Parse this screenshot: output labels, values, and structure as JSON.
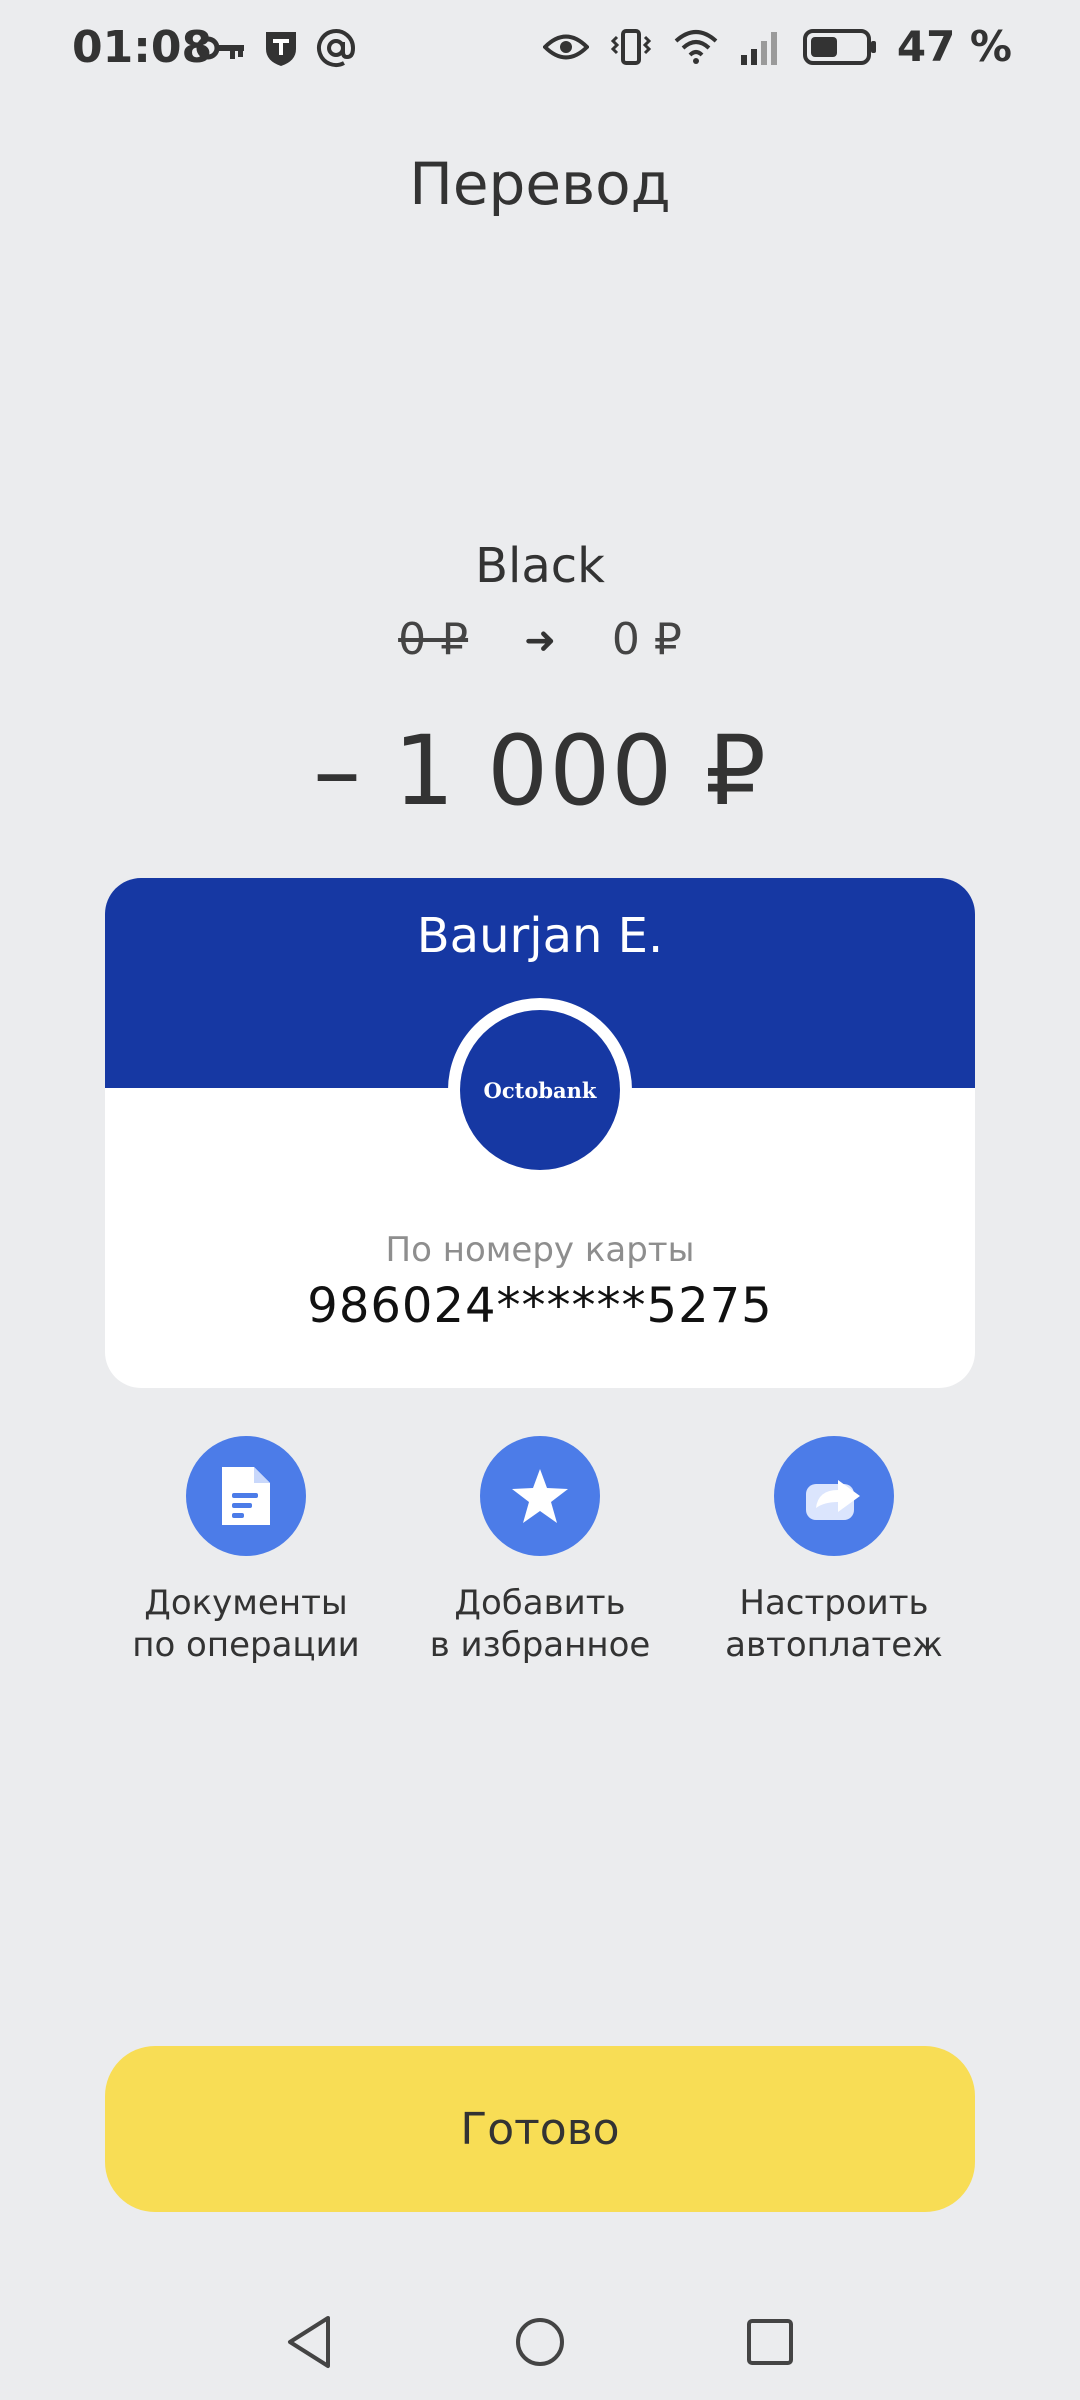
{
  "status_bar": {
    "time": "01:08",
    "left_icons": [
      "key-icon",
      "shield-t-icon",
      "at-icon"
    ],
    "right_icons": [
      "eye-icon",
      "vibrate-icon",
      "wifi-icon",
      "signal-icon",
      "battery-icon"
    ],
    "battery_percent": "47 %"
  },
  "header": {
    "title": "Перевод"
  },
  "account": {
    "name": "Black",
    "balance_before": "0 ₽",
    "balance_after": "0 ₽"
  },
  "amount": "– 1 000 ₽",
  "recipient": {
    "name": "Baurjan E.",
    "bank_logo": "Octobank",
    "method": "По номеру карты",
    "card_number": "986024******5275"
  },
  "actions": [
    {
      "line1": "Документы",
      "line2": "по операции",
      "icon": "document-icon"
    },
    {
      "line1": "Добавить",
      "line2": "в избранное",
      "icon": "star-icon"
    },
    {
      "line1": "Настроить",
      "line2": "автоплатеж",
      "icon": "autopay-icon"
    }
  ],
  "done_button": {
    "label": "Готово"
  },
  "colors": {
    "background": "#ebecee",
    "card_header": "#1638a3",
    "action_icon": "#4c7ce8",
    "done_button": "#f8dd55"
  },
  "nav_bar": {
    "icons": [
      "back-icon",
      "home-icon",
      "recents-icon"
    ]
  }
}
